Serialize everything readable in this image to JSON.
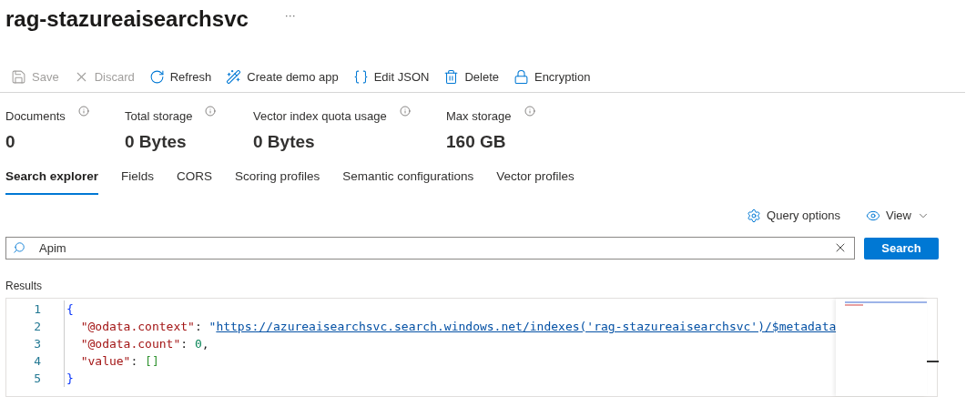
{
  "page": {
    "title": "rag-stazureaisearchsvc",
    "more": "···"
  },
  "toolbar": [
    {
      "label": "Save",
      "kind": "save",
      "disabled": true
    },
    {
      "label": "Discard",
      "kind": "discard",
      "disabled": true
    },
    {
      "label": "Refresh",
      "kind": "refresh",
      "disabled": false
    },
    {
      "label": "Create demo app",
      "kind": "demo",
      "disabled": false
    },
    {
      "label": "Edit JSON",
      "kind": "braces",
      "disabled": false
    },
    {
      "label": "Delete",
      "kind": "delete",
      "disabled": false
    },
    {
      "label": "Encryption",
      "kind": "lock",
      "disabled": false
    }
  ],
  "stats": [
    {
      "label": "Documents",
      "value": "0"
    },
    {
      "label": "Total storage",
      "value": "0 Bytes"
    },
    {
      "label": "Vector index quota usage",
      "value": "0 Bytes"
    },
    {
      "label": "Max storage",
      "value": "160 GB"
    }
  ],
  "tabs": [
    {
      "label": "Search explorer",
      "selected": true
    },
    {
      "label": "Fields",
      "selected": false
    },
    {
      "label": "CORS",
      "selected": false
    },
    {
      "label": "Scoring profiles",
      "selected": false
    },
    {
      "label": "Semantic configurations",
      "selected": false
    },
    {
      "label": "Vector profiles",
      "selected": false
    }
  ],
  "actions": [
    {
      "label": "Query options",
      "kind": "gear"
    },
    {
      "label": "View",
      "kind": "eye"
    }
  ],
  "search": {
    "value": "Apim",
    "button": "Search"
  },
  "results": {
    "label": "Results",
    "lines": [
      {
        "number": "1",
        "tokens": [
          {
            "kind": "brace",
            "text": "{"
          }
        ]
      },
      {
        "number": "2",
        "tokens": [
          {
            "kind": "key",
            "text": "  \"@odata.context\""
          },
          {
            "kind": "punct",
            "text": ": "
          },
          {
            "kind": "string",
            "text": "\""
          },
          {
            "kind": "url",
            "text": "https://azureaisearchsvc.search.windows.net/indexes('rag-stazureaisearchsvc')/$metadata"
          }
        ]
      },
      {
        "number": "3",
        "tokens": [
          {
            "kind": "key",
            "text": "  \"@odata.count\""
          },
          {
            "kind": "punct",
            "text": ": "
          },
          {
            "kind": "number",
            "text": "0"
          },
          {
            "kind": "punct",
            "text": ","
          }
        ]
      },
      {
        "number": "4",
        "tokens": [
          {
            "kind": "key",
            "text": "  \"value\""
          },
          {
            "kind": "punct",
            "text": ": "
          },
          {
            "kind": "array",
            "text": "[]"
          }
        ]
      },
      {
        "number": "5",
        "tokens": [
          {
            "kind": "brace",
            "text": "}"
          }
        ]
      }
    ]
  }
}
